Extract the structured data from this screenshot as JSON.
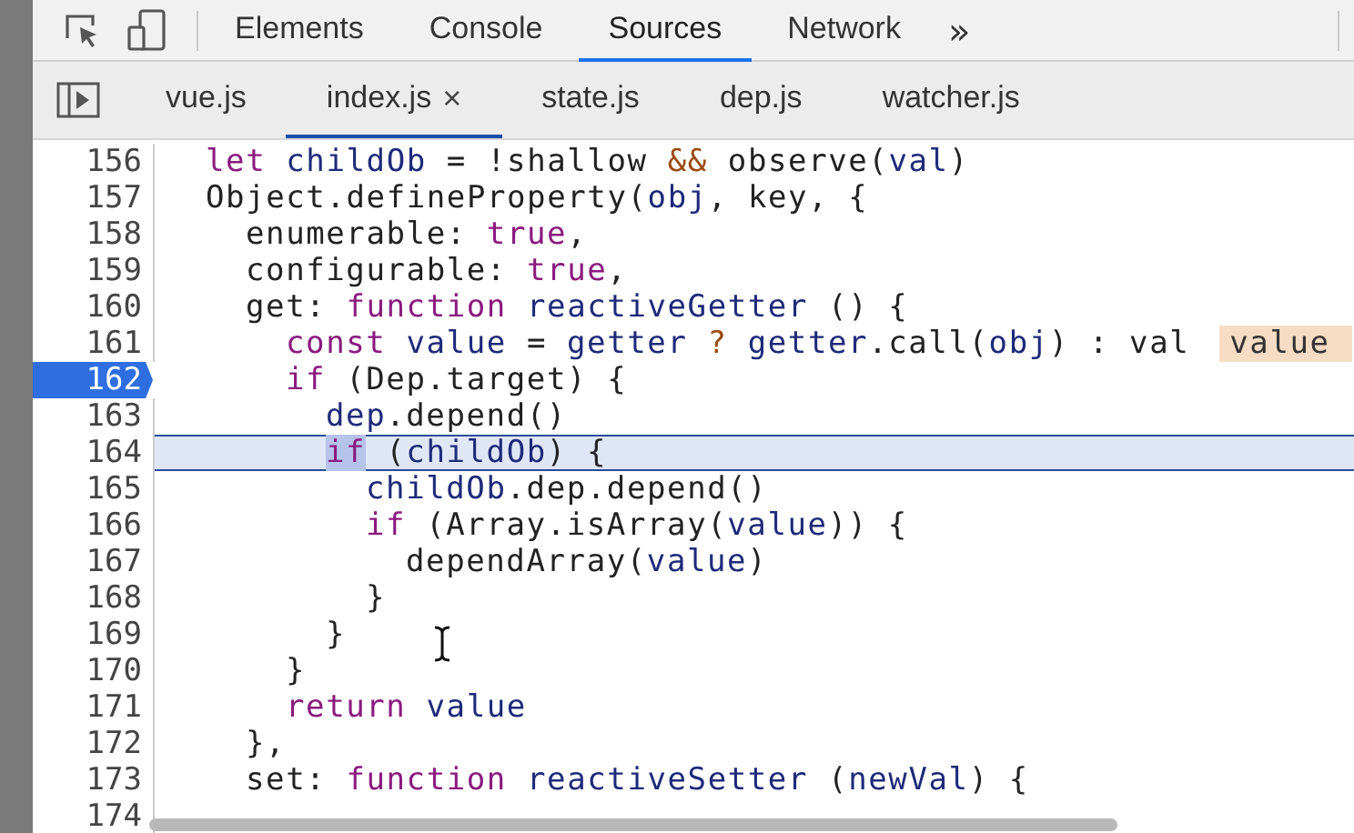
{
  "toolbar": {
    "tabs": [
      {
        "label": "Elements",
        "selected": false
      },
      {
        "label": "Console",
        "selected": false
      },
      {
        "label": "Sources",
        "selected": true
      },
      {
        "label": "Network",
        "selected": false
      }
    ],
    "more": "»"
  },
  "file_tabs": [
    {
      "label": "vue.js",
      "selected": false
    },
    {
      "label": "index.js",
      "selected": true,
      "close": "×"
    },
    {
      "label": "state.js",
      "selected": false
    },
    {
      "label": "dep.js",
      "selected": false
    },
    {
      "label": "watcher.js",
      "selected": false
    }
  ],
  "code": [
    {
      "number": "156",
      "breakpoint": false,
      "current": false,
      "tokens": [
        {
          "t": "let ",
          "kind": "kw"
        },
        {
          "t": "childOb",
          "kind": "var"
        },
        {
          "t": " = !shallow ",
          "kind": "plain"
        },
        {
          "t": "&&",
          "kind": "op"
        },
        {
          "t": " observe(",
          "kind": "plain"
        },
        {
          "t": "val",
          "kind": "var"
        },
        {
          "t": ")",
          "kind": "plain"
        }
      ]
    },
    {
      "number": "157",
      "breakpoint": false,
      "current": false,
      "tokens": [
        {
          "t": "Object.defineProperty(",
          "kind": "plain"
        },
        {
          "t": "obj",
          "kind": "var"
        },
        {
          "t": ", key, {",
          "kind": "plain"
        }
      ]
    },
    {
      "number": "158",
      "breakpoint": false,
      "current": false,
      "tokens": [
        {
          "t": "  enumerable: ",
          "kind": "plain"
        },
        {
          "t": "true",
          "kind": "kw"
        },
        {
          "t": ",",
          "kind": "plain"
        }
      ]
    },
    {
      "number": "159",
      "breakpoint": false,
      "current": false,
      "tokens": [
        {
          "t": "  configurable: ",
          "kind": "plain"
        },
        {
          "t": "true",
          "kind": "kw"
        },
        {
          "t": ",",
          "kind": "plain"
        }
      ]
    },
    {
      "number": "160",
      "breakpoint": false,
      "current": false,
      "tokens": [
        {
          "t": "  get: ",
          "kind": "plain"
        },
        {
          "t": "function ",
          "kind": "kw"
        },
        {
          "t": "reactiveGetter",
          "kind": "var"
        },
        {
          "t": " () {",
          "kind": "plain"
        }
      ]
    },
    {
      "number": "161",
      "breakpoint": false,
      "current": false,
      "inline_value": "value",
      "tokens": [
        {
          "t": "    const ",
          "kind": "kw"
        },
        {
          "t": "value",
          "kind": "var"
        },
        {
          "t": " = ",
          "kind": "plain"
        },
        {
          "t": "getter",
          "kind": "var"
        },
        {
          "t": " ? ",
          "kind": "op"
        },
        {
          "t": "getter",
          "kind": "var"
        },
        {
          "t": ".call(",
          "kind": "plain"
        },
        {
          "t": "obj",
          "kind": "var"
        },
        {
          "t": ") : val",
          "kind": "plain"
        }
      ]
    },
    {
      "number": "162",
      "breakpoint": true,
      "current": false,
      "tokens": [
        {
          "t": "    if",
          "kind": "kw"
        },
        {
          "t": " (Dep.target) {",
          "kind": "plain"
        }
      ]
    },
    {
      "number": "163",
      "breakpoint": false,
      "current": false,
      "tokens": [
        {
          "t": "      dep",
          "kind": "var"
        },
        {
          "t": ".depend()",
          "kind": "plain"
        }
      ]
    },
    {
      "number": "164",
      "breakpoint": false,
      "current": true,
      "tokens": [
        {
          "t": "      if",
          "kind": "kw",
          "highlight": true
        },
        {
          "t": " (",
          "kind": "plain"
        },
        {
          "t": "childOb",
          "kind": "var"
        },
        {
          "t": ") {",
          "kind": "plain"
        }
      ]
    },
    {
      "number": "165",
      "breakpoint": false,
      "current": false,
      "tokens": [
        {
          "t": "        childOb",
          "kind": "var"
        },
        {
          "t": ".dep.depend()",
          "kind": "plain"
        }
      ]
    },
    {
      "number": "166",
      "breakpoint": false,
      "current": false,
      "tokens": [
        {
          "t": "        if",
          "kind": "kw"
        },
        {
          "t": " (Array.isArray(",
          "kind": "plain"
        },
        {
          "t": "value",
          "kind": "var"
        },
        {
          "t": ")) {",
          "kind": "plain"
        }
      ]
    },
    {
      "number": "167",
      "breakpoint": false,
      "current": false,
      "tokens": [
        {
          "t": "          dependArray(",
          "kind": "plain"
        },
        {
          "t": "value",
          "kind": "var"
        },
        {
          "t": ")",
          "kind": "plain"
        }
      ]
    },
    {
      "number": "168",
      "breakpoint": false,
      "current": false,
      "tokens": [
        {
          "t": "        }",
          "kind": "plain"
        }
      ]
    },
    {
      "number": "169",
      "breakpoint": false,
      "current": false,
      "tokens": [
        {
          "t": "      }",
          "kind": "plain"
        }
      ]
    },
    {
      "number": "170",
      "breakpoint": false,
      "current": false,
      "tokens": [
        {
          "t": "    }",
          "kind": "plain"
        }
      ]
    },
    {
      "number": "171",
      "breakpoint": false,
      "current": false,
      "tokens": [
        {
          "t": "    return ",
          "kind": "kw"
        },
        {
          "t": "value",
          "kind": "var"
        }
      ]
    },
    {
      "number": "172",
      "breakpoint": false,
      "current": false,
      "tokens": [
        {
          "t": "  },",
          "kind": "plain"
        }
      ]
    },
    {
      "number": "173",
      "breakpoint": false,
      "current": false,
      "tokens": [
        {
          "t": "  set: ",
          "kind": "plain"
        },
        {
          "t": "function ",
          "kind": "kw"
        },
        {
          "t": "reactiveSetter",
          "kind": "var"
        },
        {
          "t": " (",
          "kind": "plain"
        },
        {
          "t": "newVal",
          "kind": "var"
        },
        {
          "t": ") {",
          "kind": "plain"
        }
      ]
    },
    {
      "number": "174",
      "breakpoint": false,
      "current": false
    }
  ]
}
